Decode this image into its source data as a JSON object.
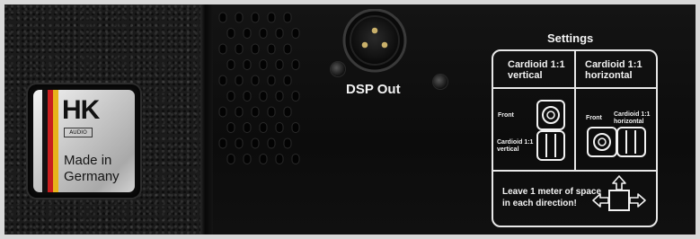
{
  "badge": {
    "logo": "HK",
    "logo_sub": "AUDIO",
    "made_in_line1": "Made in",
    "made_in_line2": "Germany",
    "flag_colors": [
      "#111111",
      "#c81e1e",
      "#e7b31b"
    ]
  },
  "connector": {
    "label": "DSP Out"
  },
  "settings": {
    "title": "Settings",
    "vertical_header_line1": "Cardioid 1:1",
    "vertical_header_line2": "vertical",
    "horizontal_header_line1": "Cardioid 1:1",
    "horizontal_header_line2": "horizontal",
    "vertical_front_label": "Front",
    "vertical_cardioid_label_line1": "Cardioid 1:1",
    "vertical_cardioid_label_line2": "vertical",
    "horizontal_front_label": "Front",
    "horizontal_cardioid_label_line1": "Cardioid 1:1",
    "horizontal_cardioid_label_line2": "horizontal",
    "space_note_line1": "Leave 1 meter of space",
    "space_note_line2": "in each direction!"
  },
  "icons": [
    "speaker-vertical-icon",
    "speaker-horizontal-icon",
    "spacing-arrows-icon",
    "xlr-connector-icon"
  ]
}
